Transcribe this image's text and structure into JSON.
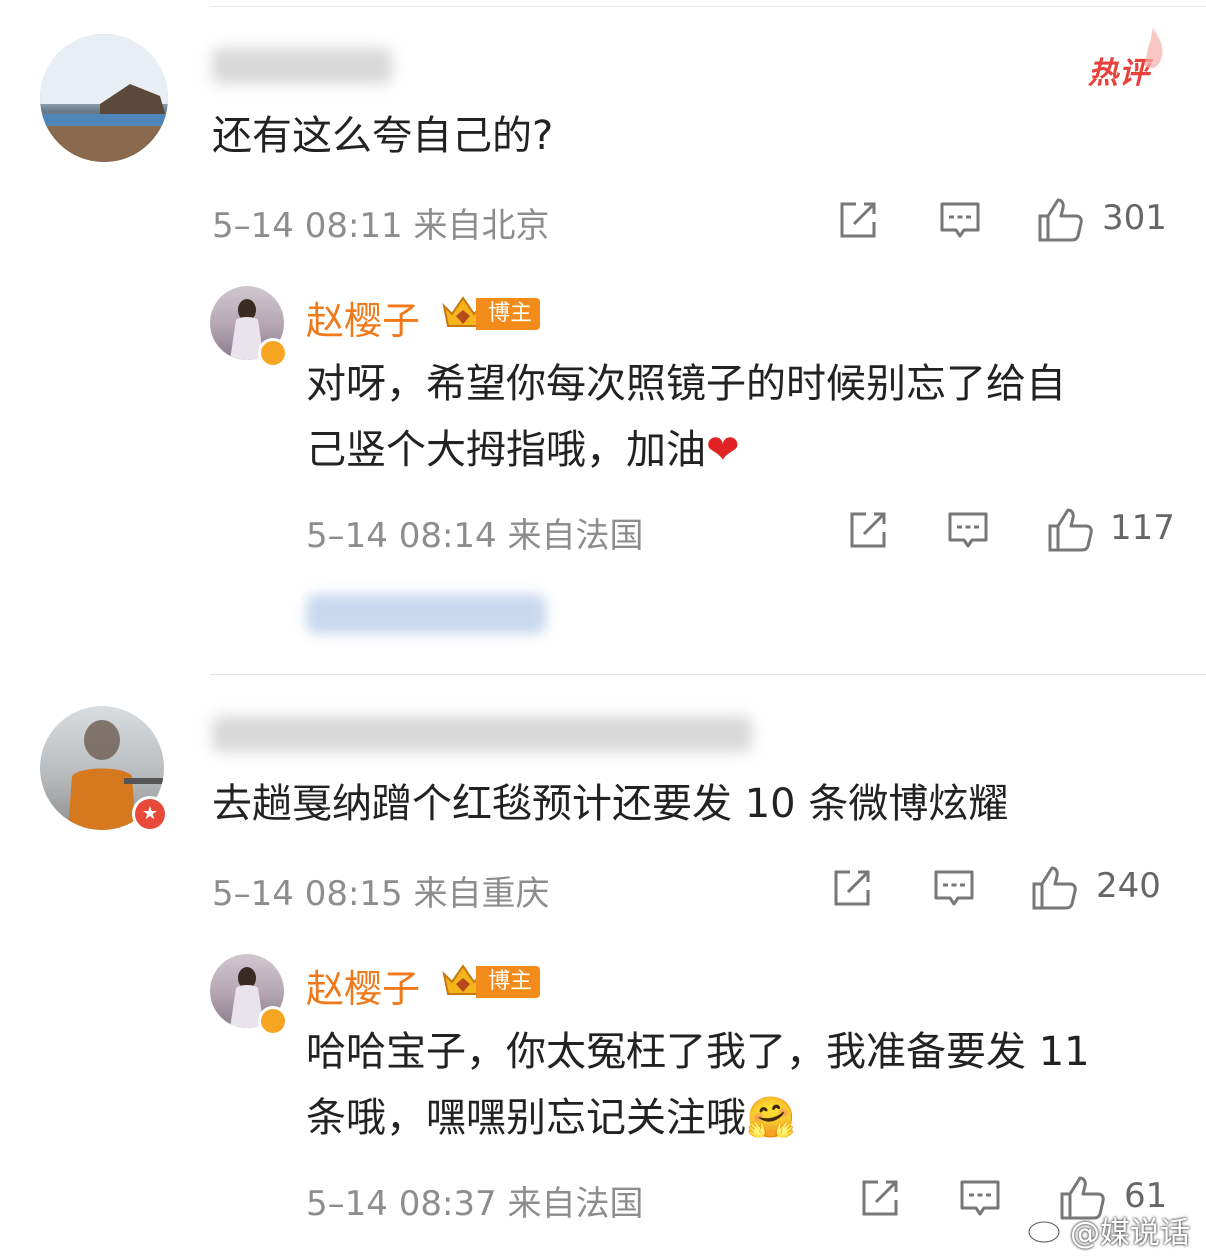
{
  "hot_label": "热评",
  "comments": [
    {
      "text": "还有这么夸自己的?",
      "meta": "5–14 08:11  来自北京",
      "likes": "301",
      "reply": {
        "name": "赵樱子",
        "badge": "博主",
        "lines": [
          "对呀，希望你每次照镜子的时候别忘了给自",
          "己竖个大拇指哦，加油"
        ],
        "emoji": "❤",
        "meta": "5–14 08:14  来自法国",
        "likes": "117"
      }
    },
    {
      "text": "去趟戛纳蹭个红毯预计还要发 10 条微博炫耀",
      "meta": "5–14 08:15  来自重庆",
      "likes": "240",
      "reply": {
        "name": "赵樱子",
        "badge": "博主",
        "lines": [
          "哈哈宝子，你太冤枉了我了，我准备要发 11",
          "条哦，嘿嘿别忘记关注哦"
        ],
        "emoji": "🤗",
        "meta": "5–14 08:37  来自法国",
        "likes": "61"
      }
    }
  ],
  "watermark": "@媒说话",
  "colors": {
    "accent": "#f07a1b",
    "hot": "#e8403a",
    "meta": "#8d8d8d"
  }
}
